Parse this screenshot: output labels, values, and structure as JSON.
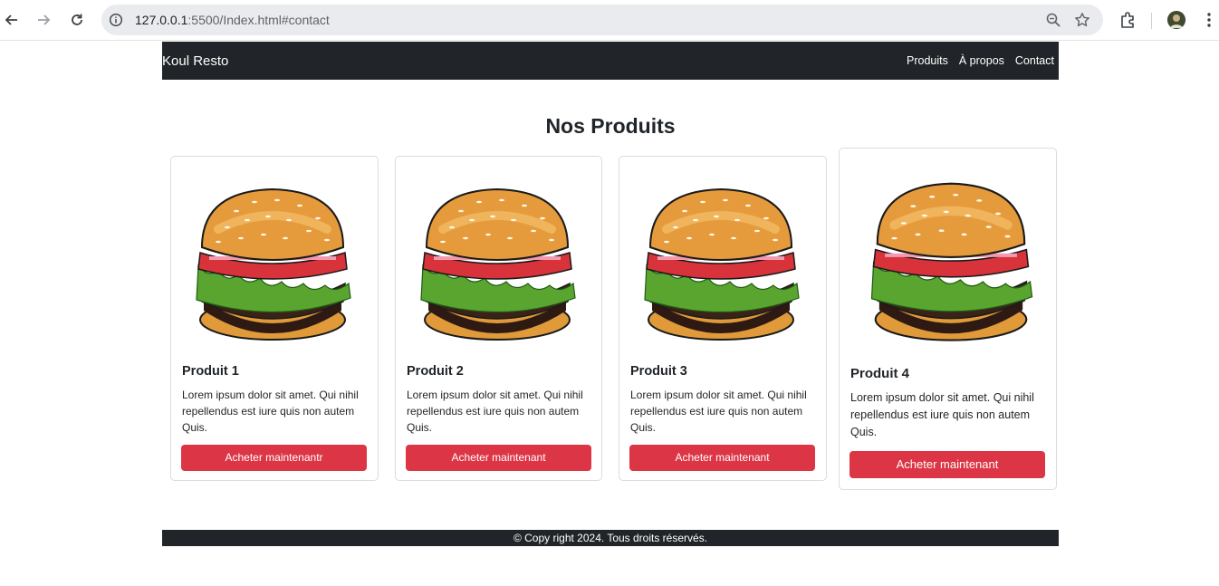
{
  "browser": {
    "url_host": "127.0.0.1",
    "url_rest": ":5500/Index.html#contact"
  },
  "site": {
    "brand": "Koul Resto",
    "nav": [
      "Produits",
      "À propos",
      "Contact"
    ]
  },
  "section": {
    "title": "Nos Produits"
  },
  "products": [
    {
      "name": "Produit 1",
      "description": "Lorem ipsum dolor sit amet. Qui nihil repellendus est iure quis non autem Quis.",
      "button": "Acheter maintenantr"
    },
    {
      "name": "Produit 2",
      "description": "Lorem ipsum dolor sit amet. Qui nihil repellendus est iure quis non autem Quis.",
      "button": "Acheter maintenant"
    },
    {
      "name": "Produit 3",
      "description": "Lorem ipsum dolor sit amet. Qui nihil repellendus est iure quis non autem Quis.",
      "button": "Acheter maintenant"
    },
    {
      "name": "Produit 4",
      "description": "Lorem ipsum dolor sit amet. Qui nihil repellendus est iure quis non autem Quis.",
      "button": "Acheter maintenant"
    }
  ],
  "footer": {
    "text": "© Copy right 2024. Tous droits réservés."
  },
  "colors": {
    "dark": "#212529",
    "accent": "#dc3545"
  }
}
